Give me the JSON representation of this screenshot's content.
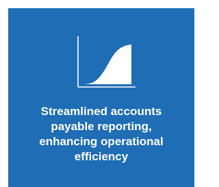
{
  "card": {
    "background_color": "#1f6db4",
    "text_color": "#ffffff",
    "icon": "growth-curve-chart-icon",
    "text_lines": [
      "Streamlined accounts",
      "payable reporting,",
      "enhancing operational",
      "efficiency"
    ]
  }
}
